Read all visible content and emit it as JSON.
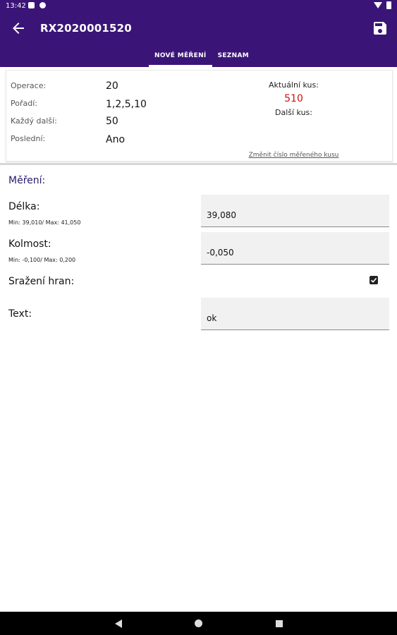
{
  "status_bar": {
    "time": "13:42",
    "icons": [
      "notification-icon",
      "at-icon",
      "wifi-icon",
      "battery-icon"
    ]
  },
  "app_bar": {
    "title": "RX2020001520",
    "back_icon": "arrow-left-icon",
    "save_icon": "floppy-disk-icon",
    "color": "#3a1577"
  },
  "tabs": [
    {
      "label": "NOVÉ MĚŘENÍ",
      "active": true
    },
    {
      "label": "SEZNAM",
      "active": false
    }
  ],
  "info": {
    "rows": [
      {
        "label": "Operace:",
        "value": "20"
      },
      {
        "label": "Pořadí:",
        "value": "1,2,5,10"
      },
      {
        "label": "Každý další:",
        "value": "50"
      },
      {
        "label": "Poslední:",
        "value": "Ano"
      }
    ],
    "current_label": "Aktuální kus:",
    "current_value": "510",
    "next_label": "Další kus:",
    "next_value": "",
    "change_link": "Změnit číslo měřeného kusu",
    "current_value_color": "#d01010"
  },
  "measurement": {
    "section_title": "Měření:",
    "fields": [
      {
        "label": "Délka:",
        "sub": "Min: 39,010/ Max: 41,050",
        "value": "39,080"
      },
      {
        "label": "Kolmost:",
        "sub": "Min: -0,100/ Max: 0,200",
        "value": "-0,050"
      },
      {
        "label": "Sražení hran:",
        "checked": true
      },
      {
        "label": "Text:",
        "value": "ok"
      }
    ]
  },
  "nav_bar": {
    "icons": [
      "nav-back-icon",
      "nav-home-icon",
      "nav-recents-icon"
    ]
  }
}
